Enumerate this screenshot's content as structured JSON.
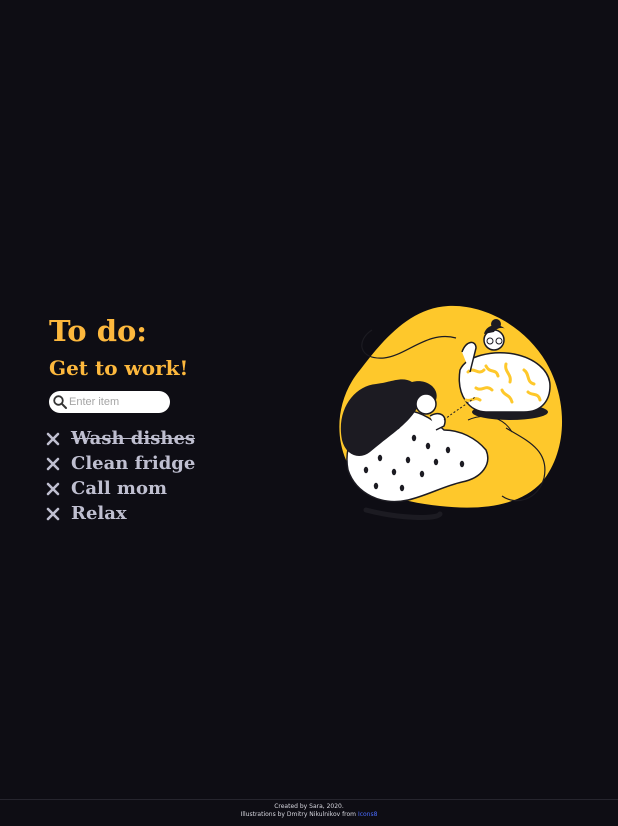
{
  "header": {
    "title": "To do:",
    "subtitle": "Get to work!"
  },
  "search": {
    "placeholder": "Enter item",
    "value": "",
    "icon": "search-icon"
  },
  "items": [
    {
      "label": "Wash dishes",
      "done": true
    },
    {
      "label": "Clean fridge",
      "done": false
    },
    {
      "label": "Call mom",
      "done": false
    },
    {
      "label": "Relax",
      "done": false
    }
  ],
  "footer": {
    "credit": "Created by Sara, 2020.",
    "illustration_prefix": "Illustrations by Dmitry Nikulnikov from ",
    "link": "Icons8"
  },
  "colors": {
    "background": "#0e0d14",
    "accent": "#fdb83d",
    "item_text": "#bfbfd0",
    "blob": "#fec82b",
    "link": "#4a6cff"
  }
}
